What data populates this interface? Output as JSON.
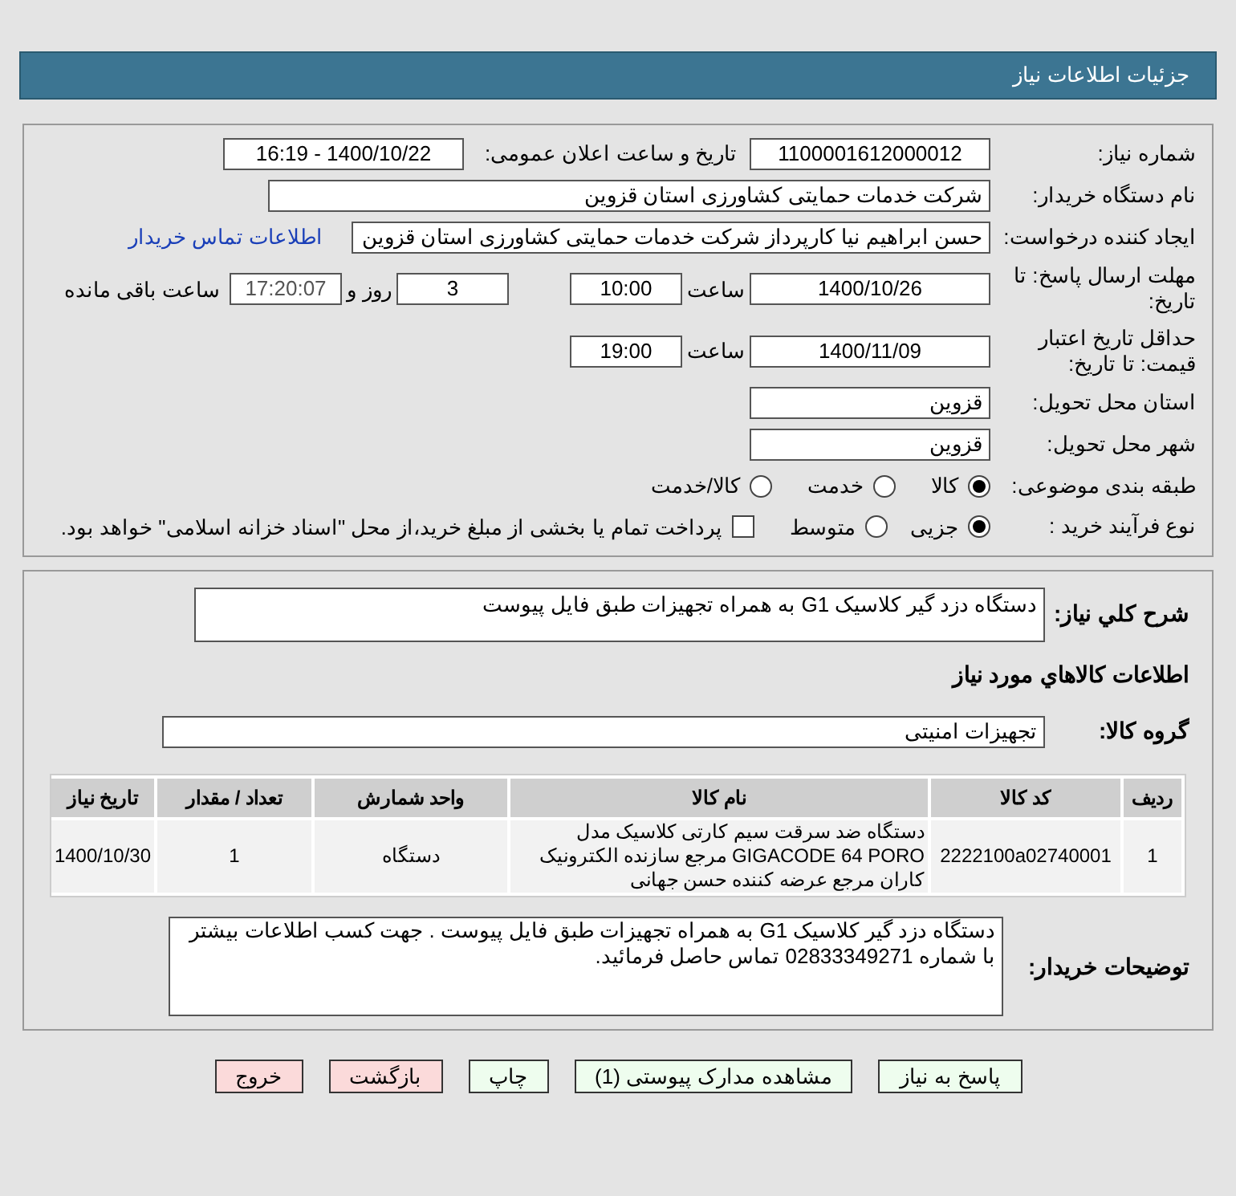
{
  "header": {
    "title": "جزئیات اطلاعات نیاز"
  },
  "need_number": {
    "label": "شماره نیاز:",
    "value": "1100001612000012"
  },
  "announce": {
    "label": "تاریخ و ساعت اعلان عمومی:",
    "value": "1400/10/22 - 16:19"
  },
  "buyer_org": {
    "label": "نام دستگاه خریدار:",
    "value": "شرکت خدمات حمایتی کشاورزی استان قزوین"
  },
  "requester": {
    "label": "ایجاد کننده درخواست:",
    "value": "حسن ابراهیم نیا کارپرداز شرکت خدمات حمایتی کشاورزی استان قزوین",
    "link": "اطلاعات تماس خریدار"
  },
  "deadline": {
    "label": "مهلت ارسال پاسخ: تا تاریخ:",
    "date": "1400/10/26",
    "time_label": "ساعت",
    "time": "10:00",
    "days": "3",
    "days_label": "روز و",
    "remaining": "17:20:07",
    "remaining_label": "ساعت باقی مانده"
  },
  "validity": {
    "label": "حداقل تاریخ اعتبار قیمت: تا تاریخ:",
    "date": "1400/11/09",
    "time_label": "ساعت",
    "time": "19:00"
  },
  "province": {
    "label": "استان محل تحویل:",
    "value": "قزوین"
  },
  "city": {
    "label": "شهر محل تحویل:",
    "value": "قزوین"
  },
  "category": {
    "label": "طبقه بندی موضوعی:",
    "options": [
      {
        "label": "کالا",
        "selected": true
      },
      {
        "label": "خدمت",
        "selected": false
      },
      {
        "label": "کالا/خدمت",
        "selected": false
      }
    ]
  },
  "purchase_type": {
    "label": "نوع فرآیند خرید :",
    "options": [
      {
        "label": "جزیی",
        "selected": true
      },
      {
        "label": "متوسط",
        "selected": false
      }
    ],
    "payment": {
      "label": "پرداخت تمام یا بخشی از مبلغ خرید،از محل \"اسناد خزانه اسلامی\" خواهد بود.",
      "checked": false
    }
  },
  "description": {
    "label": "شرح کلي نياز:",
    "value": "دستگاه دزد گیر کلاسیک G1 به همراه تجهیزات طبق فایل پیوست"
  },
  "goods_heading": "اطلاعات کالاهاي مورد نياز",
  "goods_group": {
    "label": "گروه کالا:",
    "value": "تجهیزات امنیتی"
  },
  "table": {
    "columns": [
      "ردیف",
      "کد کالا",
      "نام کالا",
      "واحد شمارش",
      "تعداد / مقدار",
      "تاریخ نیاز"
    ],
    "rows": [
      [
        "1",
        "2222100a02740001",
        "دستگاه ضد سرقت سیم کارتی کلاسیک مدل GIGACODE 64 PORO مرجع سازنده الکترونیک کاران مرجع عرضه کننده حسن جهانی",
        "دستگاه",
        "1",
        "1400/10/30"
      ]
    ]
  },
  "buyer_notes": {
    "label": "توضیحات خریدار:",
    "value": "دستگاه دزد گیر کلاسیک G1 به همراه تجهیزات طبق فایل پیوست . جهت کسب اطلاعات بیشتر با شماره 02833349271 تماس حاصل فرمائید."
  },
  "buttons": [
    {
      "label": "پاسخ به نیاز",
      "kind": "action"
    },
    {
      "label": "مشاهده مدارک پیوستی (1)",
      "kind": "action"
    },
    {
      "label": "چاپ",
      "kind": "action"
    },
    {
      "label": "بازگشت",
      "kind": "exit"
    },
    {
      "label": "خروج",
      "kind": "exit"
    }
  ]
}
